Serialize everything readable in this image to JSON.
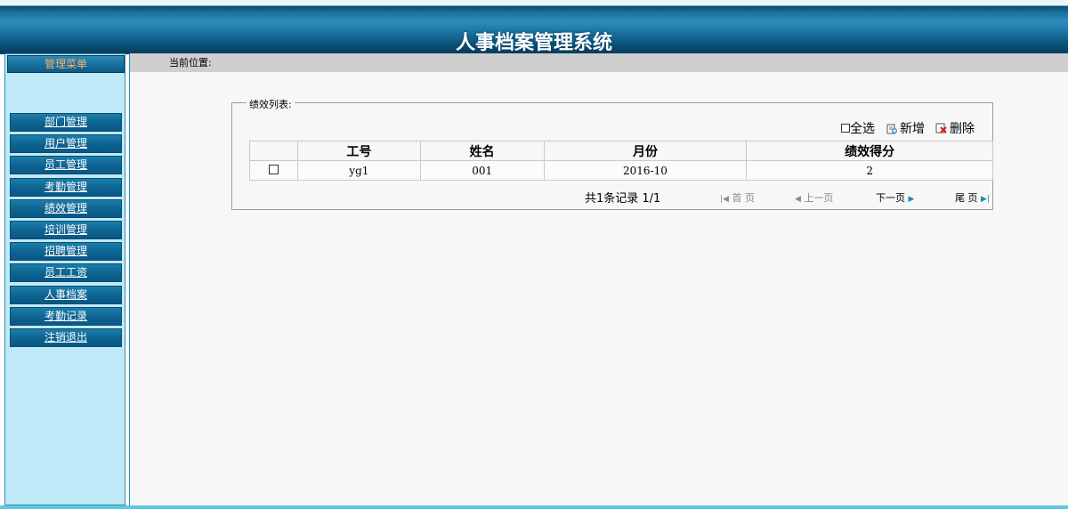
{
  "header": {
    "title": "人事档案管理系统"
  },
  "sidebar": {
    "heading": "管理菜单",
    "items": [
      {
        "label": "部门管理"
      },
      {
        "label": "用户管理"
      },
      {
        "label": "员工管理"
      },
      {
        "label": "考勤管理"
      },
      {
        "label": "绩效管理"
      },
      {
        "label": "培训管理"
      },
      {
        "label": "招聘管理"
      },
      {
        "label": "员工工资"
      },
      {
        "label": "人事档案"
      },
      {
        "label": "考勤记录"
      },
      {
        "label": "注销退出"
      }
    ]
  },
  "location": {
    "label": "当前位置:"
  },
  "panel": {
    "legend": "绩效列表:",
    "toolbar": {
      "select_all": "全选",
      "add": "新增",
      "delete": "删除"
    },
    "table": {
      "headers": [
        "",
        "工号",
        "姓名",
        "月份",
        "绩效得分"
      ],
      "rows": [
        {
          "emp_no": "yg1",
          "name": "001",
          "month": "2016-10",
          "score": "2"
        }
      ]
    },
    "pager": {
      "total": "共1条记录  1/1",
      "first": "首 页",
      "prev": "上一页",
      "next": "下一页",
      "last": "尾 页"
    }
  },
  "colors": {
    "header_dark": "#0b4b6e",
    "sidebar_bg": "#bfe9f7",
    "menu_item": "#0d6592",
    "menu_head_text": "#f6b36b",
    "location_bar": "#cfcfcf",
    "teal_arrow": "#1a8fb5"
  }
}
